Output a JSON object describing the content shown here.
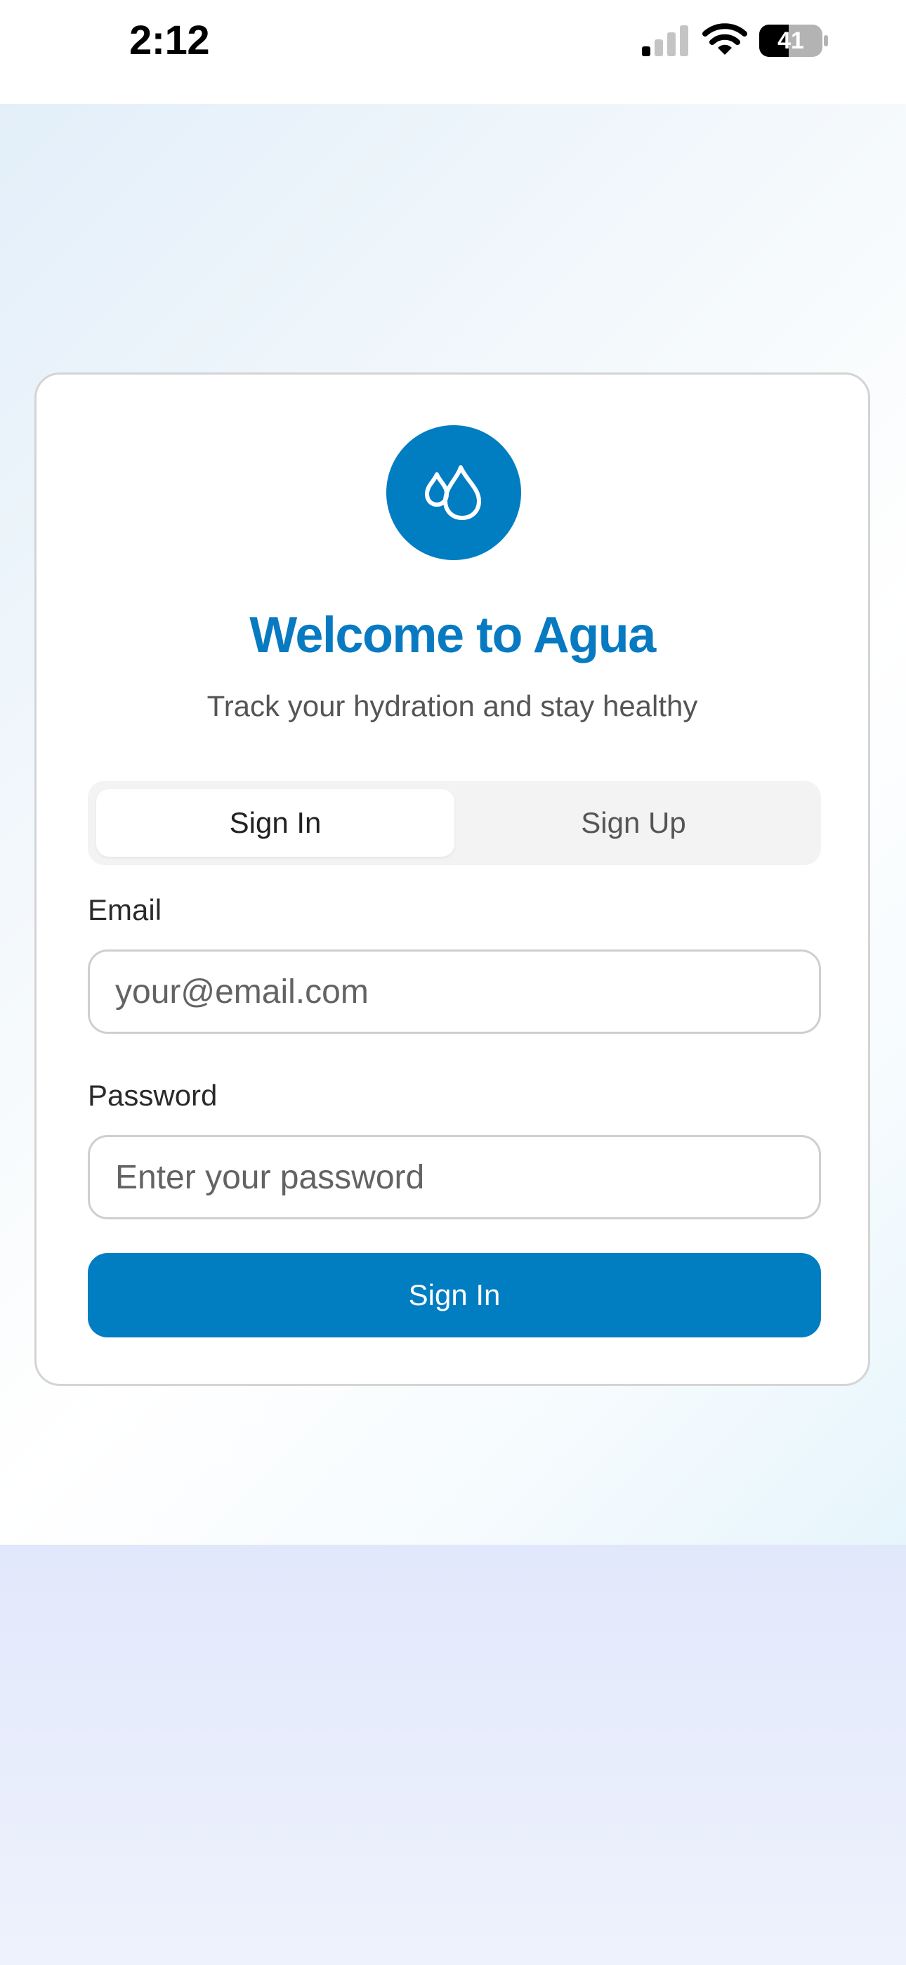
{
  "status_bar": {
    "time": "2:12",
    "battery_level": "41",
    "icons": [
      "cellular-signal-icon",
      "wifi-icon",
      "battery-icon"
    ]
  },
  "colors": {
    "brand": "#017dc2",
    "title": "#087ac1",
    "text_secondary": "#555555"
  },
  "login_card": {
    "logo_icon": "water-drops-icon",
    "title": "Welcome to Agua",
    "subtitle": "Track your hydration and stay healthy",
    "tabs": [
      {
        "label": "Sign In",
        "active": true
      },
      {
        "label": "Sign Up",
        "active": false
      }
    ],
    "email": {
      "label": "Email",
      "placeholder": "your@email.com",
      "value": ""
    },
    "password": {
      "label": "Password",
      "placeholder": "Enter your password",
      "value": ""
    },
    "submit_label": "Sign In"
  }
}
